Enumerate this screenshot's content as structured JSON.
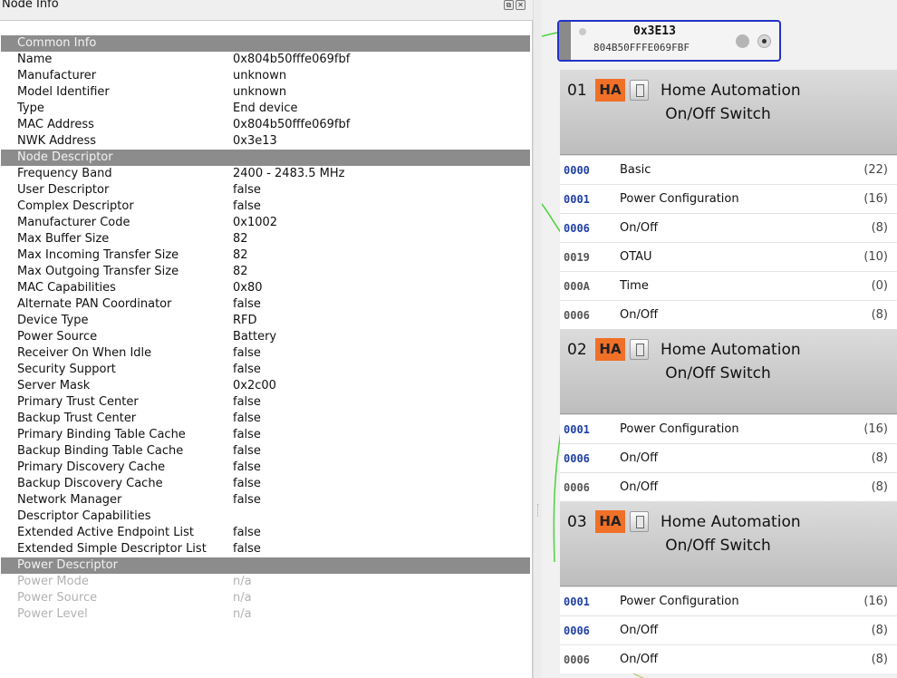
{
  "panel": {
    "title": "Node Info",
    "float_icon": "float-icon",
    "close_icon": "close-icon",
    "float_glyph": "⧉",
    "close_glyph": "✕"
  },
  "sections": [
    {
      "title": "Common Info",
      "rows": [
        {
          "key": "Name",
          "value": "0x804b50fffe069fbf"
        },
        {
          "key": "Manufacturer",
          "value": "unknown"
        },
        {
          "key": "Model Identifier",
          "value": "unknown"
        },
        {
          "key": "Type",
          "value": "End device"
        },
        {
          "key": "MAC Address",
          "value": "0x804b50fffe069fbf"
        },
        {
          "key": "NWK Address",
          "value": "0x3e13"
        }
      ]
    },
    {
      "title": "Node Descriptor",
      "rows": [
        {
          "key": "Frequency Band",
          "value": "2400 - 2483.5 MHz"
        },
        {
          "key": "User Descriptor",
          "value": "false"
        },
        {
          "key": "Complex Descriptor",
          "value": "false"
        },
        {
          "key": "Manufacturer Code",
          "value": "0x1002"
        },
        {
          "key": "Max Buffer Size",
          "value": "82"
        },
        {
          "key": "Max Incoming Transfer Size",
          "value": "82"
        },
        {
          "key": "Max Outgoing Transfer Size",
          "value": "82"
        },
        {
          "key": "MAC Capabilities",
          "value": "0x80"
        },
        {
          "key": "Alternate PAN Coordinator",
          "value": "false"
        },
        {
          "key": "Device Type",
          "value": "RFD"
        },
        {
          "key": "Power Source",
          "value": "Battery"
        },
        {
          "key": "Receiver On When Idle",
          "value": "false"
        },
        {
          "key": "Security Support",
          "value": "false"
        },
        {
          "key": "Server Mask",
          "value": "0x2c00"
        },
        {
          "key": "Primary Trust Center",
          "value": "false"
        },
        {
          "key": "Backup Trust Center",
          "value": "false"
        },
        {
          "key": "Primary Binding Table Cache",
          "value": "false"
        },
        {
          "key": "Backup Binding Table Cache",
          "value": "false"
        },
        {
          "key": "Primary Discovery Cache",
          "value": "false"
        },
        {
          "key": "Backup Discovery Cache",
          "value": "false"
        },
        {
          "key": "Network Manager",
          "value": "false"
        },
        {
          "key": "Descriptor Capabilities",
          "value": ""
        },
        {
          "key": "Extended Active Endpoint List",
          "value": "false"
        },
        {
          "key": "Extended Simple Descriptor List",
          "value": "false"
        }
      ]
    },
    {
      "title": "Power Descriptor",
      "dim": true,
      "rows": [
        {
          "key": "Power Mode",
          "value": "n/a"
        },
        {
          "key": "Power Source",
          "value": "n/a"
        },
        {
          "key": "Power Level",
          "value": "n/a"
        }
      ]
    }
  ],
  "node": {
    "nwk": "0x3E13",
    "mac": "804B50FFFE069FBF",
    "border_color": "#2432c8"
  },
  "endpoints": [
    {
      "num": "01",
      "badge": "HA",
      "profile": "Home Automation",
      "device": "On/Off Switch",
      "clusters": [
        {
          "id": "0000",
          "name": "Basic",
          "count": "(22)",
          "kind": "server"
        },
        {
          "id": "0001",
          "name": "Power Configuration",
          "count": "(16)",
          "kind": "server"
        },
        {
          "id": "0006",
          "name": "On/Off",
          "count": "(8)",
          "kind": "server"
        },
        {
          "id": "0019",
          "name": "OTAU",
          "count": "(10)",
          "kind": "client"
        },
        {
          "id": "000A",
          "name": "Time",
          "count": "(0)",
          "kind": "client"
        },
        {
          "id": "0006",
          "name": "On/Off",
          "count": "(8)",
          "kind": "client"
        }
      ]
    },
    {
      "num": "02",
      "badge": "HA",
      "profile": "Home Automation",
      "device": "On/Off Switch",
      "clusters": [
        {
          "id": "0001",
          "name": "Power Configuration",
          "count": "(16)",
          "kind": "server"
        },
        {
          "id": "0006",
          "name": "On/Off",
          "count": "(8)",
          "kind": "server"
        },
        {
          "id": "0006",
          "name": "On/Off",
          "count": "(8)",
          "kind": "client"
        }
      ]
    },
    {
      "num": "03",
      "badge": "HA",
      "profile": "Home Automation",
      "device": "On/Off Switch",
      "clusters": [
        {
          "id": "0001",
          "name": "Power Configuration",
          "count": "(16)",
          "kind": "server"
        },
        {
          "id": "0006",
          "name": "On/Off",
          "count": "(8)",
          "kind": "server"
        },
        {
          "id": "0006",
          "name": "On/Off",
          "count": "(8)",
          "kind": "client"
        }
      ]
    }
  ],
  "colors": {
    "section_header": "#8c8c8c",
    "ha_badge": "#f07028",
    "server_cluster_id": "#1f3fa6",
    "client_cluster_id": "#555555",
    "link_line": "#4bd23c"
  }
}
